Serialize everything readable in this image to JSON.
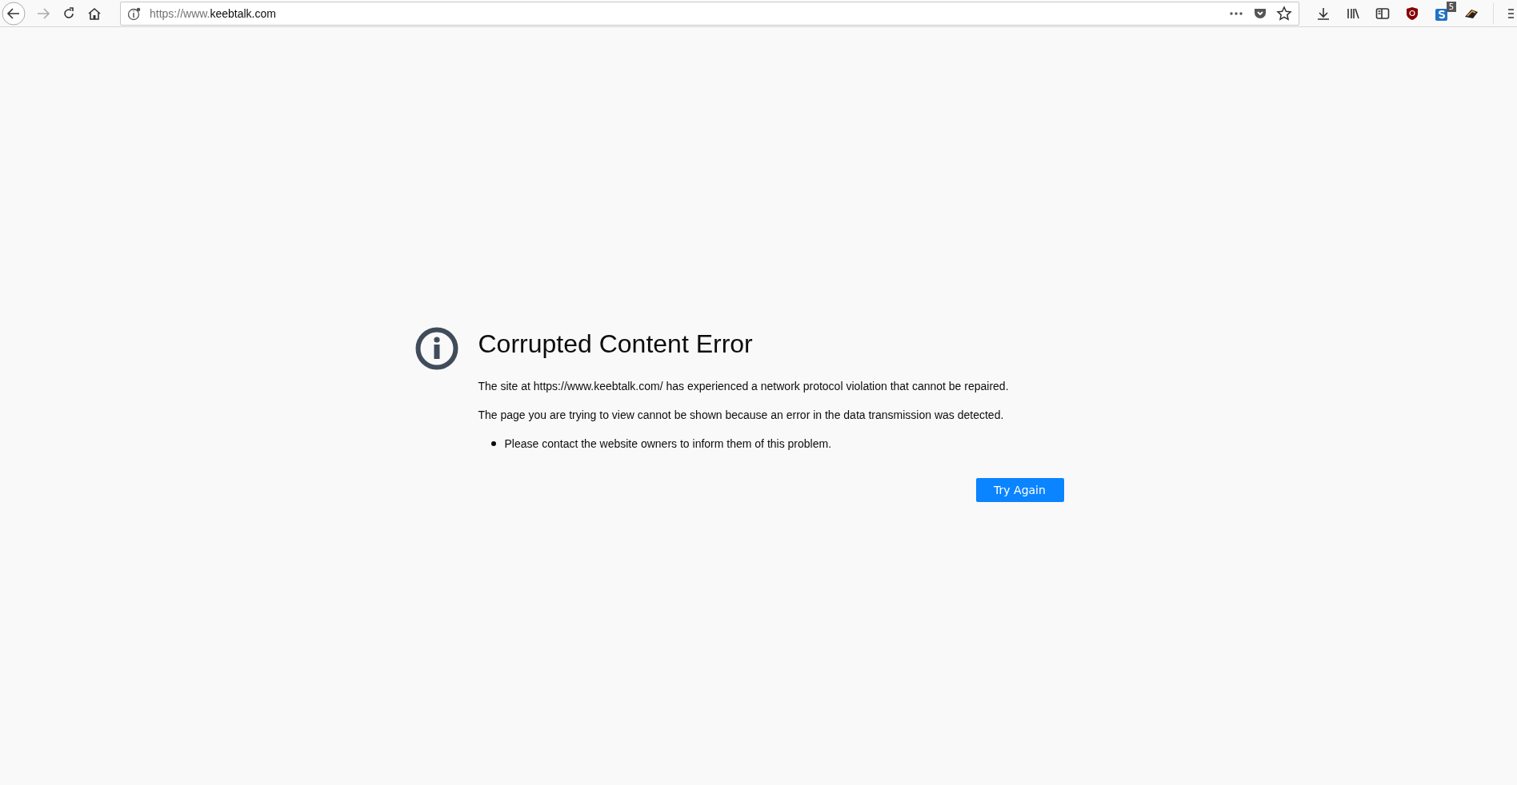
{
  "toolbar": {
    "url_prefix": "https://www.",
    "url_domain": "keebtalk.com",
    "badge": "5"
  },
  "error": {
    "title": "Corrupted Content Error",
    "paragraphs": [
      "The site at https://www.keebtalk.com/ has experienced a network protocol violation that cannot be repaired.",
      "The page you are trying to view cannot be shown because an error in the data transmission was detected."
    ],
    "bullets": [
      "Please contact the website owners to inform them of this problem."
    ],
    "button": "Try Again"
  }
}
